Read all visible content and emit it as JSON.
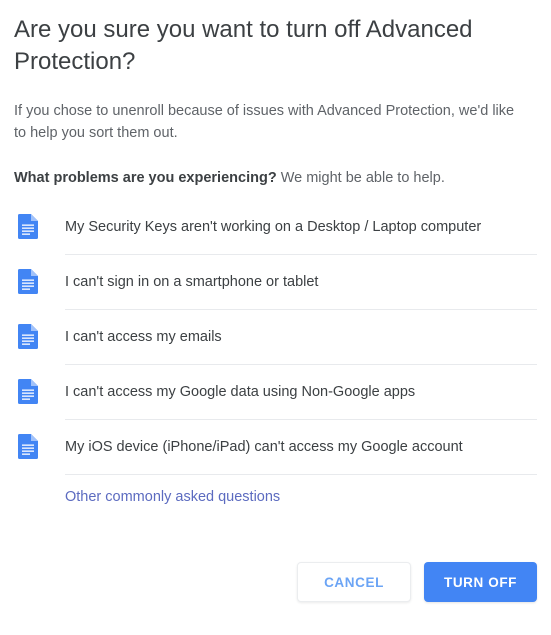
{
  "dialog": {
    "title": "Are you sure you want to turn off Advanced Protection?",
    "body": "If you chose to unenroll because of issues with Advanced Protection, we'd like to help you sort them out.",
    "prompt_strong": "What problems are you experiencing?",
    "prompt_rest": " We might be able to help.",
    "issues": [
      {
        "icon": "document-icon",
        "label": "My Security Keys aren't working on a Desktop / Laptop computer"
      },
      {
        "icon": "document-icon",
        "label": "I can't sign in on a smartphone or tablet"
      },
      {
        "icon": "document-icon",
        "label": "I can't access my emails"
      },
      {
        "icon": "document-icon",
        "label": "I can't access my Google data using Non-Google apps"
      },
      {
        "icon": "document-icon",
        "label": "My iOS device (iPhone/iPad) can't access my Google account"
      }
    ],
    "other_link": "Other commonly asked questions",
    "actions": {
      "cancel_label": "CANCEL",
      "confirm_label": "TURN OFF"
    },
    "colors": {
      "accent": "#4285f4",
      "link": "#5c6bc0",
      "cancel_text": "#6ba4f5",
      "title_text": "#3c4043",
      "body_text": "#5f6368",
      "divider": "#e8eaed",
      "icon_blue": "#4285f4",
      "icon_fold": "#a1c2fa",
      "background": "#ffffff"
    }
  }
}
